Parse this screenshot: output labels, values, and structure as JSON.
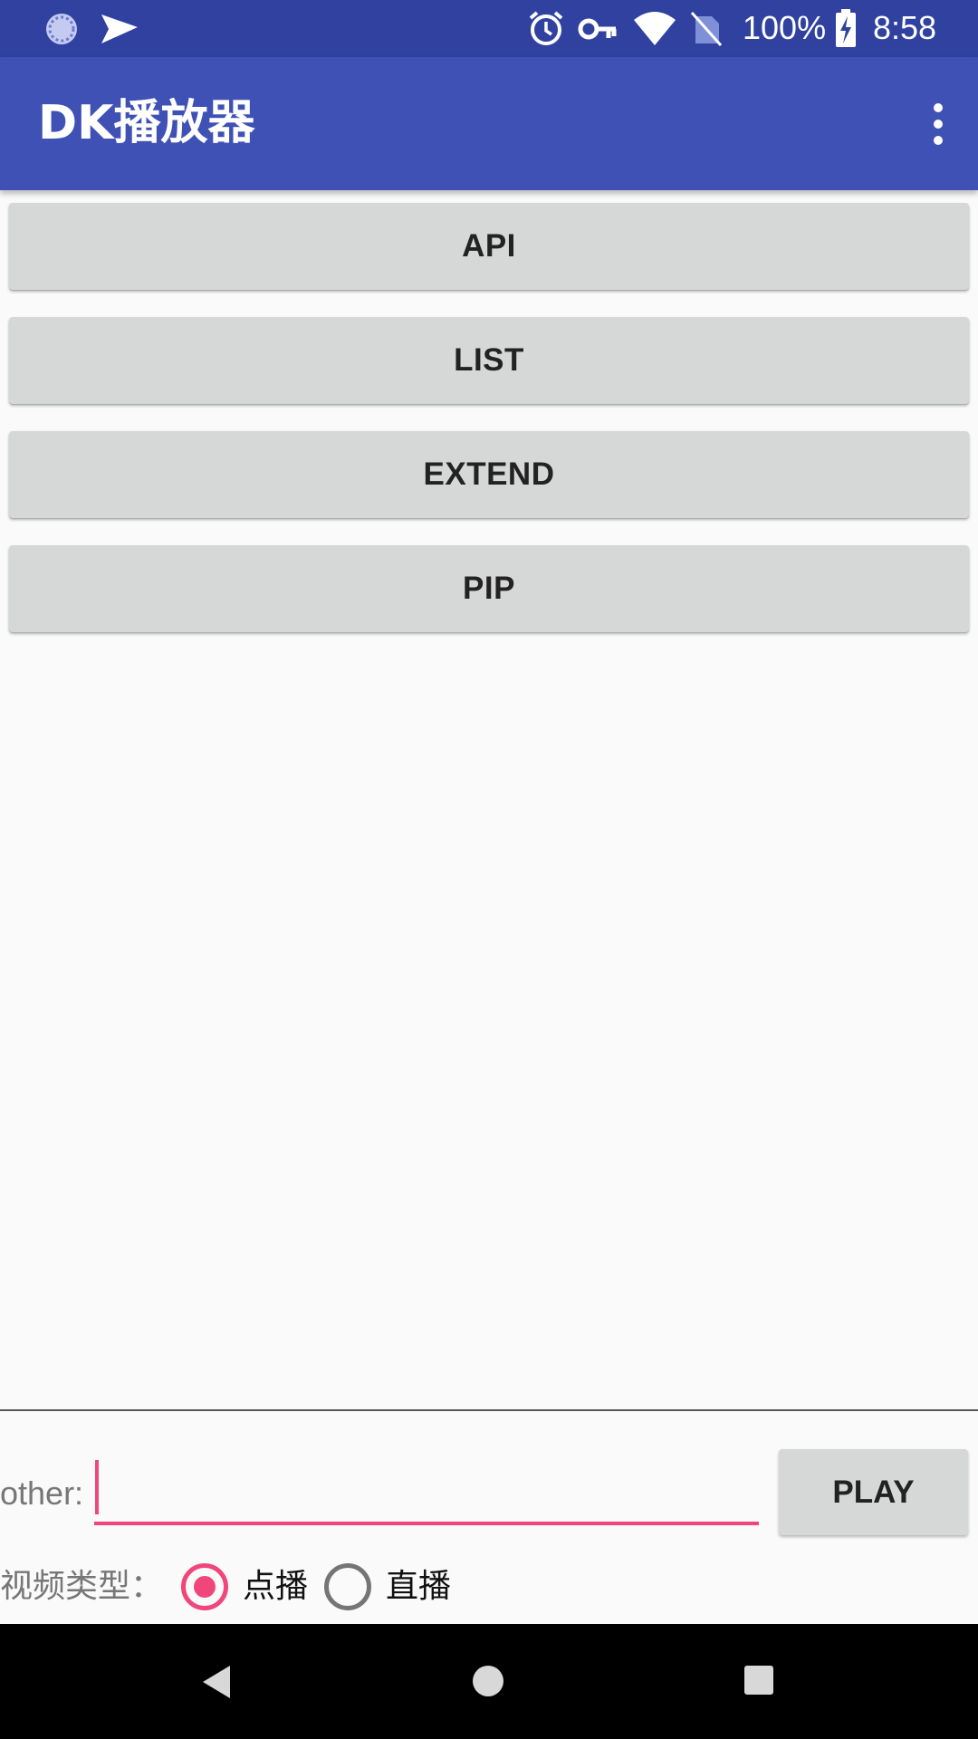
{
  "status_bar": {
    "battery": "100%",
    "time": "8:58",
    "icons": [
      "sync-icon",
      "send-icon",
      "alarm-icon",
      "vpn-key-icon",
      "wifi-icon",
      "no-sim-icon",
      "battery-charging-icon"
    ]
  },
  "app_bar": {
    "title": "DK播放器",
    "menu_icon": "more-vert-icon"
  },
  "buttons": {
    "api": "API",
    "list": "LIST",
    "extend": "EXTEND",
    "pip": "PIP"
  },
  "other_input": {
    "label": "other:",
    "value": "",
    "play": "PLAY"
  },
  "video_type": {
    "label": "视频类型：",
    "options": [
      {
        "label": "点播",
        "selected": true
      },
      {
        "label": "直播",
        "selected": false
      }
    ]
  },
  "colors": {
    "status_bar": "#3041a0",
    "app_bar": "#3f51b5",
    "accent": "#f0467c",
    "button": "#d6d7d7",
    "background": "#fafafa"
  }
}
